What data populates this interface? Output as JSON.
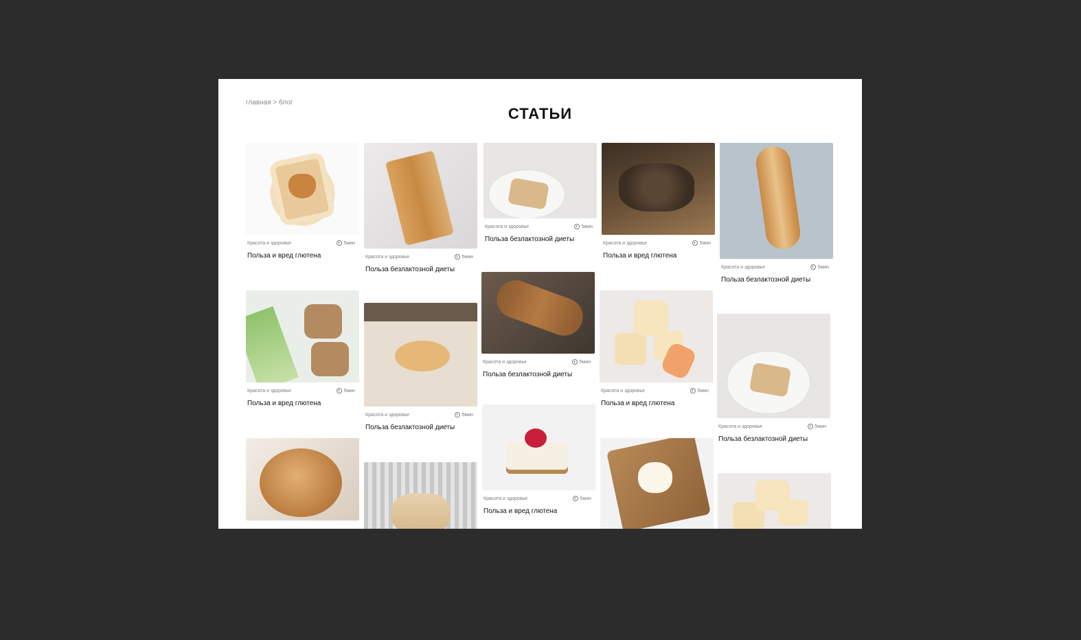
{
  "breadcrumb": "главная > блог",
  "title": "СТАТЬИ",
  "cards": [
    {
      "category": "Красота и здоровье",
      "time": "5мин",
      "title": "Польза и вред глютена",
      "image": "toast-dog-photo"
    },
    {
      "category": "Красота и здоровье",
      "time": "5мин",
      "title": "Польза безлактозной диеты",
      "image": "cutting-board-photo"
    },
    {
      "category": "Красота и здоровье",
      "time": "5мин",
      "title": "Польза безлактозной диеты",
      "image": "breakfast-table-photo"
    },
    {
      "category": "Красота и здоровье",
      "time": "5мин",
      "title": "Польза и вред глютена",
      "image": "rye-bread-photo"
    },
    {
      "category": "Красота и здоровье",
      "time": "5мин",
      "title": "Польза безлактозной диеты",
      "image": "baguette-photo"
    },
    {
      "category": "Красота и здоровье",
      "time": "5мин",
      "title": "Польза и вред глютена",
      "image": "bread-packs-photo"
    },
    {
      "category": "Красота и здоровье",
      "time": "5мин",
      "title": "Польза безлактозной диеты",
      "image": "kneading-dough-photo"
    },
    {
      "category": "Красота и здоровье",
      "time": "5мин",
      "title": "Польза безлактозной диеты",
      "image": "sliced-loaves-photo"
    },
    {
      "category": "Красота и здоровье",
      "time": "5мин",
      "title": "Польза и вред глютена",
      "image": "bread-slices-photo"
    },
    {
      "category": "Красота и здоровье",
      "time": "5мин",
      "title": "Польза безлактозной диеты",
      "image": "breakfast-plate-photo"
    },
    {
      "category": "",
      "time": "",
      "title": "",
      "image": "round-loaf-photo"
    },
    {
      "category": "",
      "time": "",
      "title": "",
      "image": "cookies-photo"
    },
    {
      "category": "Красота и здоровье",
      "time": "5мин",
      "title": "Польза и вред глютена",
      "image": "canape-photo"
    },
    {
      "category": "",
      "time": "",
      "title": "",
      "image": "butter-bread-photo"
    },
    {
      "category": "",
      "time": "",
      "title": "",
      "image": "bread-slices-photo-2"
    }
  ]
}
